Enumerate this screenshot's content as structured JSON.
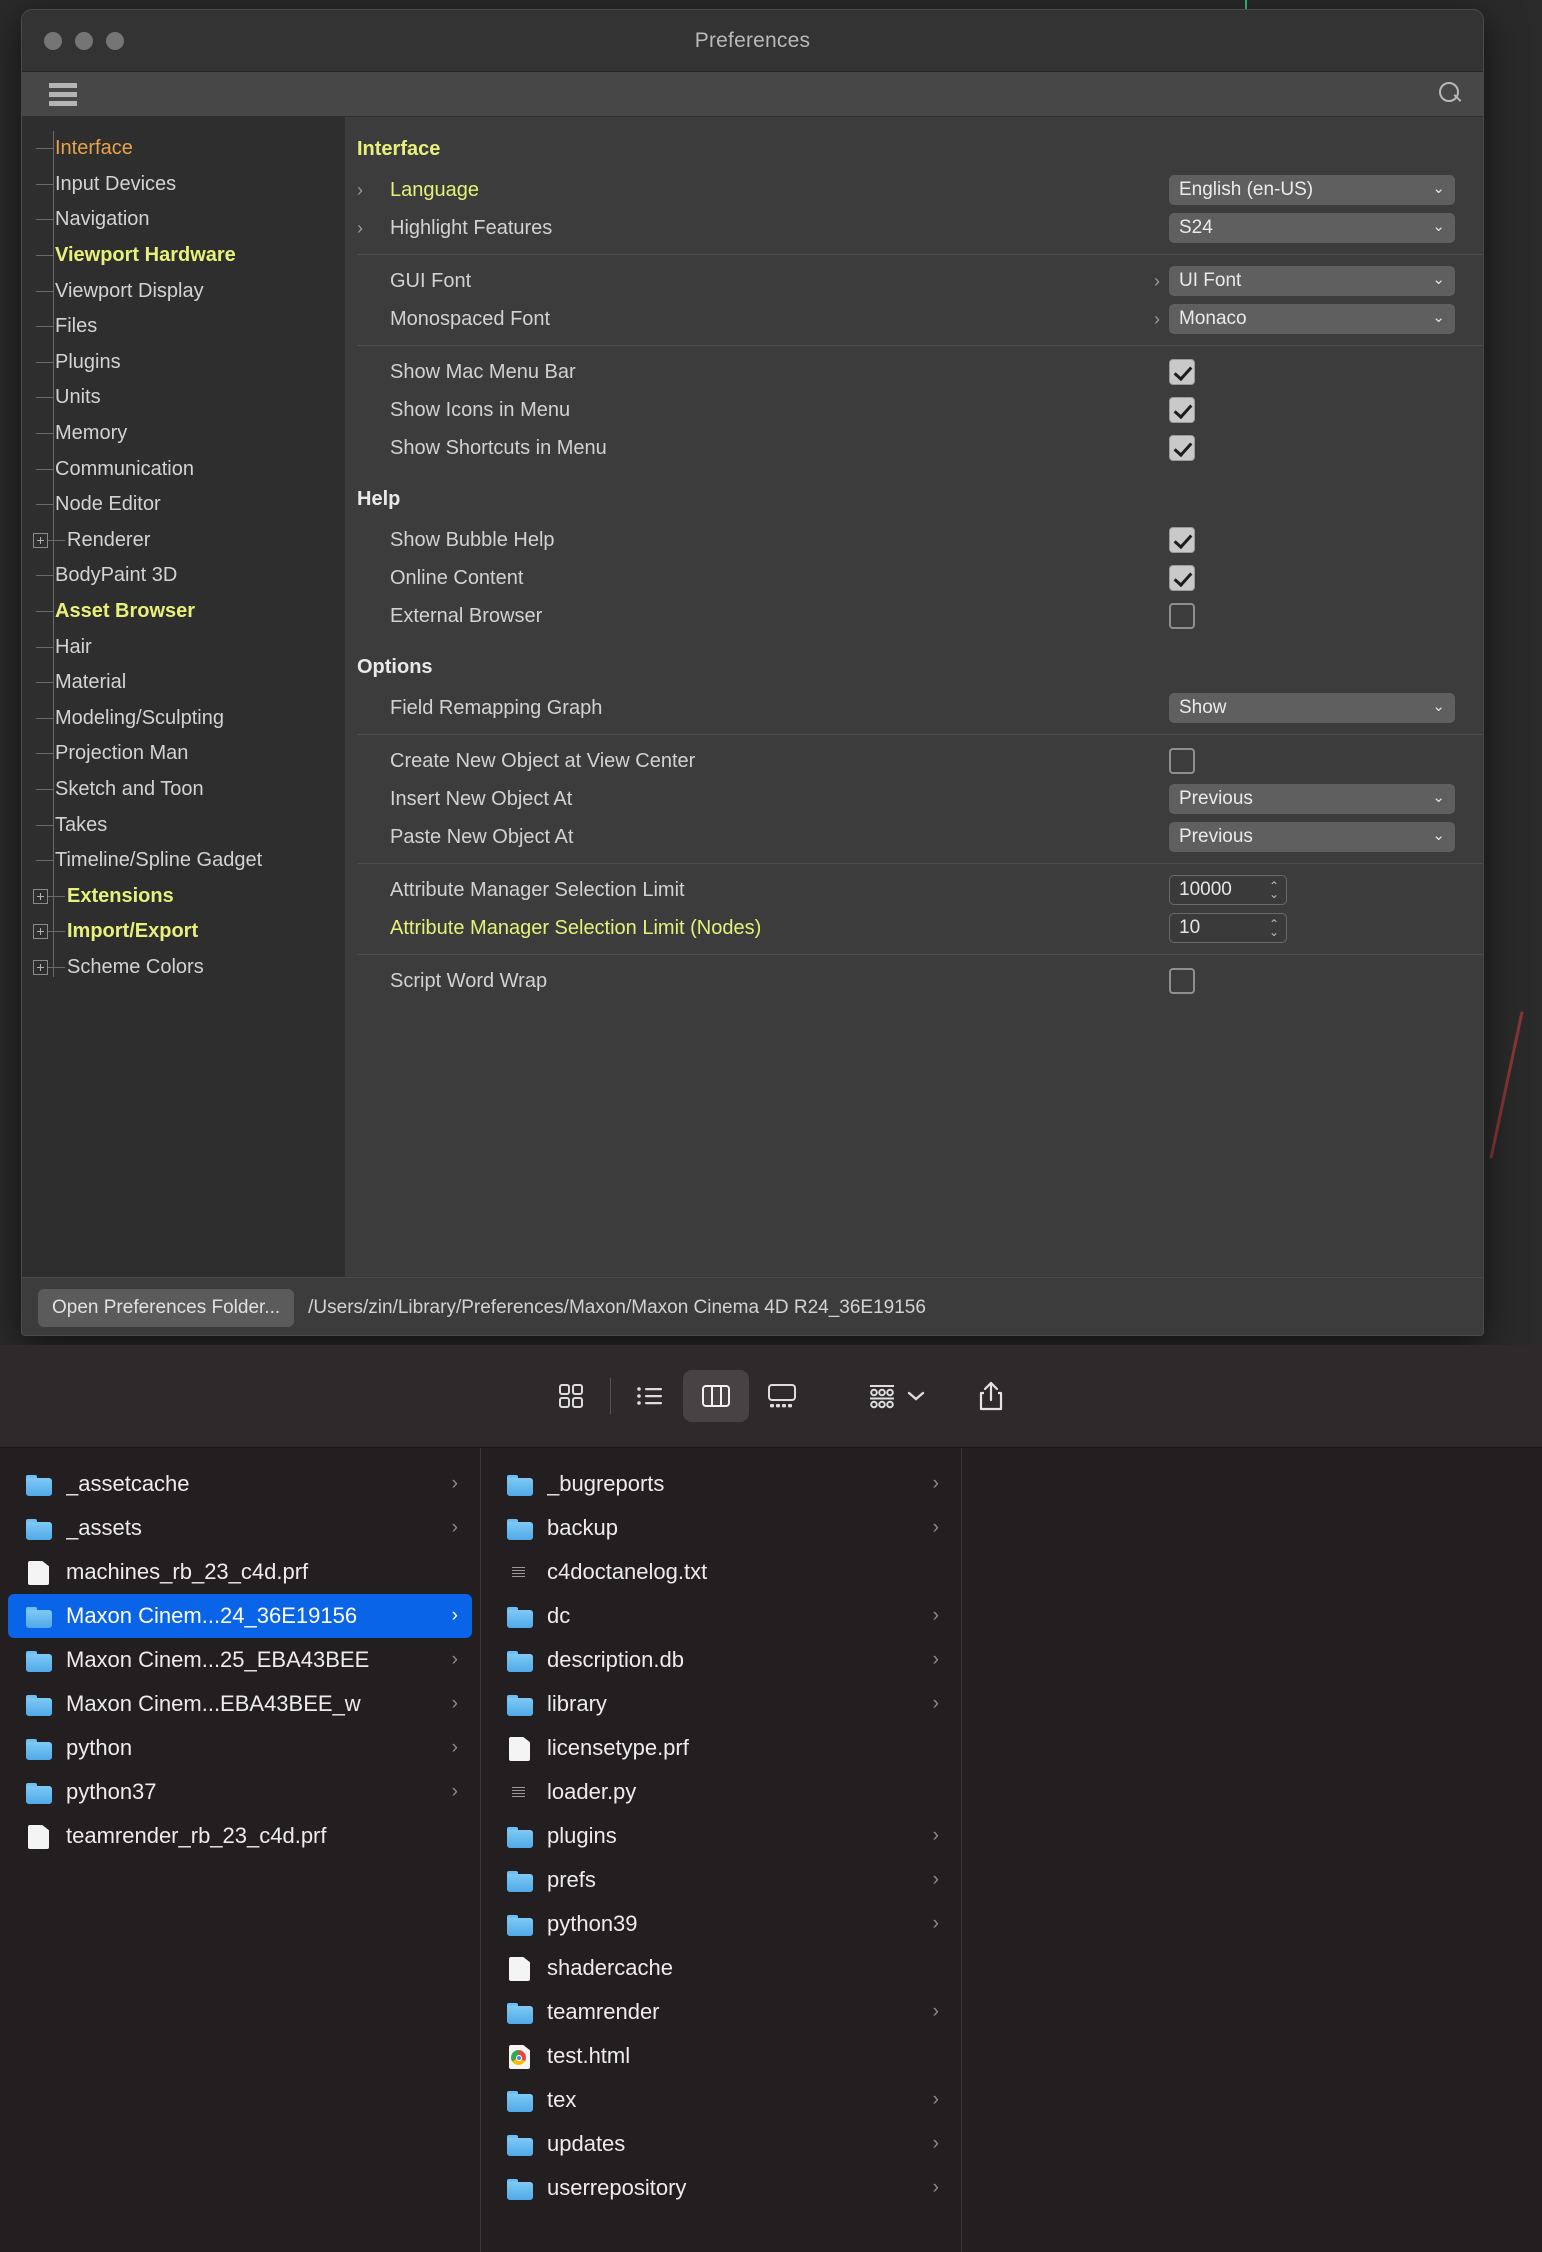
{
  "window": {
    "title": "Preferences",
    "traffic_lights": [
      "close",
      "minimize",
      "zoom"
    ]
  },
  "toolbar": {
    "menu_icon": "hamburger-icon",
    "search_icon": "search-icon"
  },
  "sidebar": {
    "items": [
      {
        "label": "Interface",
        "color": "orange",
        "expandable": false
      },
      {
        "label": "Input Devices",
        "color": "white",
        "expandable": false
      },
      {
        "label": "Navigation",
        "color": "white",
        "expandable": false
      },
      {
        "label": "Viewport Hardware",
        "color": "yellow",
        "expandable": false
      },
      {
        "label": "Viewport Display",
        "color": "white",
        "expandable": false
      },
      {
        "label": "Files",
        "color": "white",
        "expandable": false
      },
      {
        "label": "Plugins",
        "color": "white",
        "expandable": false
      },
      {
        "label": "Units",
        "color": "white",
        "expandable": false
      },
      {
        "label": "Memory",
        "color": "white",
        "expandable": false
      },
      {
        "label": "Communication",
        "color": "white",
        "expandable": false
      },
      {
        "label": "Node Editor",
        "color": "white",
        "expandable": false
      },
      {
        "label": "Renderer",
        "color": "white",
        "expandable": true
      },
      {
        "label": "BodyPaint 3D",
        "color": "white",
        "expandable": false
      },
      {
        "label": "Asset Browser",
        "color": "yellow",
        "expandable": false
      },
      {
        "label": "Hair",
        "color": "white",
        "expandable": false
      },
      {
        "label": "Material",
        "color": "white",
        "expandable": false
      },
      {
        "label": "Modeling/Sculpting",
        "color": "white",
        "expandable": false
      },
      {
        "label": "Projection Man",
        "color": "white",
        "expandable": false
      },
      {
        "label": "Sketch and Toon",
        "color": "white",
        "expandable": false
      },
      {
        "label": "Takes",
        "color": "white",
        "expandable": false
      },
      {
        "label": "Timeline/Spline Gadget",
        "color": "white",
        "expandable": false
      },
      {
        "label": "Extensions",
        "color": "yellow",
        "expandable": true
      },
      {
        "label": "Import/Export",
        "color": "yellow",
        "expandable": true
      },
      {
        "label": "Scheme Colors",
        "color": "white",
        "expandable": true
      }
    ]
  },
  "main": {
    "groups": [
      {
        "title": "Interface",
        "title_color": "yellow",
        "rows": [
          {
            "label": "Language",
            "label_color": "yellow",
            "chevron": true,
            "control": "dropdown",
            "value": "English (en-US)"
          },
          {
            "label": "Highlight Features",
            "label_color": "white",
            "chevron": true,
            "control": "dropdown",
            "value": "S24"
          }
        ]
      },
      {
        "title": "",
        "rows": [
          {
            "label": "GUI Font",
            "label_color": "white",
            "pre_chevron": true,
            "control": "dropdown",
            "value": "UI Font"
          },
          {
            "label": "Monospaced Font",
            "label_color": "white",
            "pre_chevron": true,
            "control": "dropdown",
            "value": "Monaco"
          }
        ]
      },
      {
        "title": "",
        "rows": [
          {
            "label": "Show Mac Menu Bar",
            "label_color": "white",
            "control": "checkbox",
            "checked": true
          },
          {
            "label": "Show Icons in Menu",
            "label_color": "white",
            "control": "checkbox",
            "checked": true
          },
          {
            "label": "Show Shortcuts in Menu",
            "label_color": "white",
            "control": "checkbox",
            "checked": true
          }
        ]
      },
      {
        "title": "Help",
        "title_color": "white",
        "rows": [
          {
            "label": "Show Bubble Help",
            "label_color": "white",
            "control": "checkbox",
            "checked": true
          },
          {
            "label": "Online Content",
            "label_color": "white",
            "control": "checkbox",
            "checked": true
          },
          {
            "label": "External Browser",
            "label_color": "white",
            "control": "checkbox",
            "checked": false
          }
        ]
      },
      {
        "title": "Options",
        "title_color": "white",
        "rows": [
          {
            "label": "Field Remapping Graph",
            "label_color": "white",
            "control": "dropdown",
            "value": "Show"
          }
        ]
      },
      {
        "title": "",
        "rows": [
          {
            "label": "Create New Object at View Center",
            "label_color": "white",
            "control": "checkbox",
            "checked": false
          },
          {
            "label": "Insert New Object At",
            "label_color": "white",
            "control": "dropdown",
            "value": "Previous"
          },
          {
            "label": "Paste New Object At",
            "label_color": "white",
            "control": "dropdown",
            "value": "Previous"
          }
        ]
      },
      {
        "title": "",
        "rows": [
          {
            "label": "Attribute Manager Selection Limit",
            "label_color": "white",
            "control": "spinner",
            "value": "10000"
          },
          {
            "label": "Attribute Manager Selection Limit (Nodes)",
            "label_color": "yellow",
            "control": "spinner",
            "value": "10"
          }
        ]
      },
      {
        "title": "",
        "rows": [
          {
            "label": "Script Word Wrap",
            "label_color": "white",
            "control": "checkbox",
            "checked": false
          }
        ]
      }
    ]
  },
  "footer": {
    "button_label": "Open Preferences Folder...",
    "path": "/Users/zin/Library/Preferences/Maxon/Maxon Cinema 4D R24_36E19156"
  },
  "finder": {
    "toolbar": {
      "views": [
        {
          "name": "icon-view-icon",
          "active": false
        },
        {
          "name": "list-view-icon",
          "active": false
        },
        {
          "name": "column-view-icon",
          "active": true
        },
        {
          "name": "gallery-view-icon",
          "active": false
        }
      ],
      "group_icon": "group-by-icon",
      "group_chevron": "chevron-down-icon",
      "share_icon": "share-icon"
    },
    "columns": [
      {
        "items": [
          {
            "name": "_assetcache",
            "type": "folder",
            "arrow": true,
            "selected": false
          },
          {
            "name": "_assets",
            "type": "folder",
            "arrow": true,
            "selected": false
          },
          {
            "name": "machines_rb_23_c4d.prf",
            "type": "file",
            "arrow": false,
            "selected": false
          },
          {
            "name": "Maxon Cinem...24_36E19156",
            "type": "folder",
            "arrow": true,
            "selected": true
          },
          {
            "name": "Maxon Cinem...25_EBA43BEE",
            "type": "folder",
            "arrow": true,
            "selected": false
          },
          {
            "name": "Maxon Cinem...EBA43BEE_w",
            "type": "folder",
            "arrow": true,
            "selected": false
          },
          {
            "name": "python",
            "type": "folder",
            "arrow": true,
            "selected": false
          },
          {
            "name": "python37",
            "type": "folder",
            "arrow": true,
            "selected": false
          },
          {
            "name": "teamrender_rb_23_c4d.prf",
            "type": "file",
            "arrow": false,
            "selected": false
          }
        ]
      },
      {
        "items": [
          {
            "name": "_bugreports",
            "type": "folder",
            "arrow": true,
            "selected": false
          },
          {
            "name": "backup",
            "type": "folder",
            "arrow": true,
            "selected": false
          },
          {
            "name": "c4doctanelog.txt",
            "type": "filetxt",
            "arrow": false,
            "selected": false
          },
          {
            "name": "dc",
            "type": "folder",
            "arrow": true,
            "selected": false
          },
          {
            "name": "description.db",
            "type": "folder",
            "arrow": true,
            "selected": false
          },
          {
            "name": "library",
            "type": "folder",
            "arrow": true,
            "selected": false
          },
          {
            "name": "licensetype.prf",
            "type": "file",
            "arrow": false,
            "selected": false
          },
          {
            "name": "loader.py",
            "type": "filetxt",
            "arrow": false,
            "selected": false
          },
          {
            "name": "plugins",
            "type": "folder",
            "arrow": true,
            "selected": false
          },
          {
            "name": "prefs",
            "type": "folder",
            "arrow": true,
            "selected": false
          },
          {
            "name": "python39",
            "type": "folder",
            "arrow": true,
            "selected": false
          },
          {
            "name": "shadercache",
            "type": "file",
            "arrow": false,
            "selected": false
          },
          {
            "name": "teamrender",
            "type": "folder",
            "arrow": true,
            "selected": false
          },
          {
            "name": "test.html",
            "type": "html",
            "arrow": false,
            "selected": false
          },
          {
            "name": "tex",
            "type": "folder",
            "arrow": true,
            "selected": false
          },
          {
            "name": "updates",
            "type": "folder",
            "arrow": true,
            "selected": false
          },
          {
            "name": "userrepository",
            "type": "folder",
            "arrow": true,
            "selected": false
          }
        ]
      },
      {
        "items": []
      }
    ]
  },
  "colors": {
    "accent_selection": "#0a64e8",
    "highlight_yellow": "#e9f07a",
    "highlight_orange": "#e8a24a",
    "window_bg": "#3c3c3c",
    "sidebar_bg": "#2e2e2e",
    "finder_bg": "#231f20"
  }
}
